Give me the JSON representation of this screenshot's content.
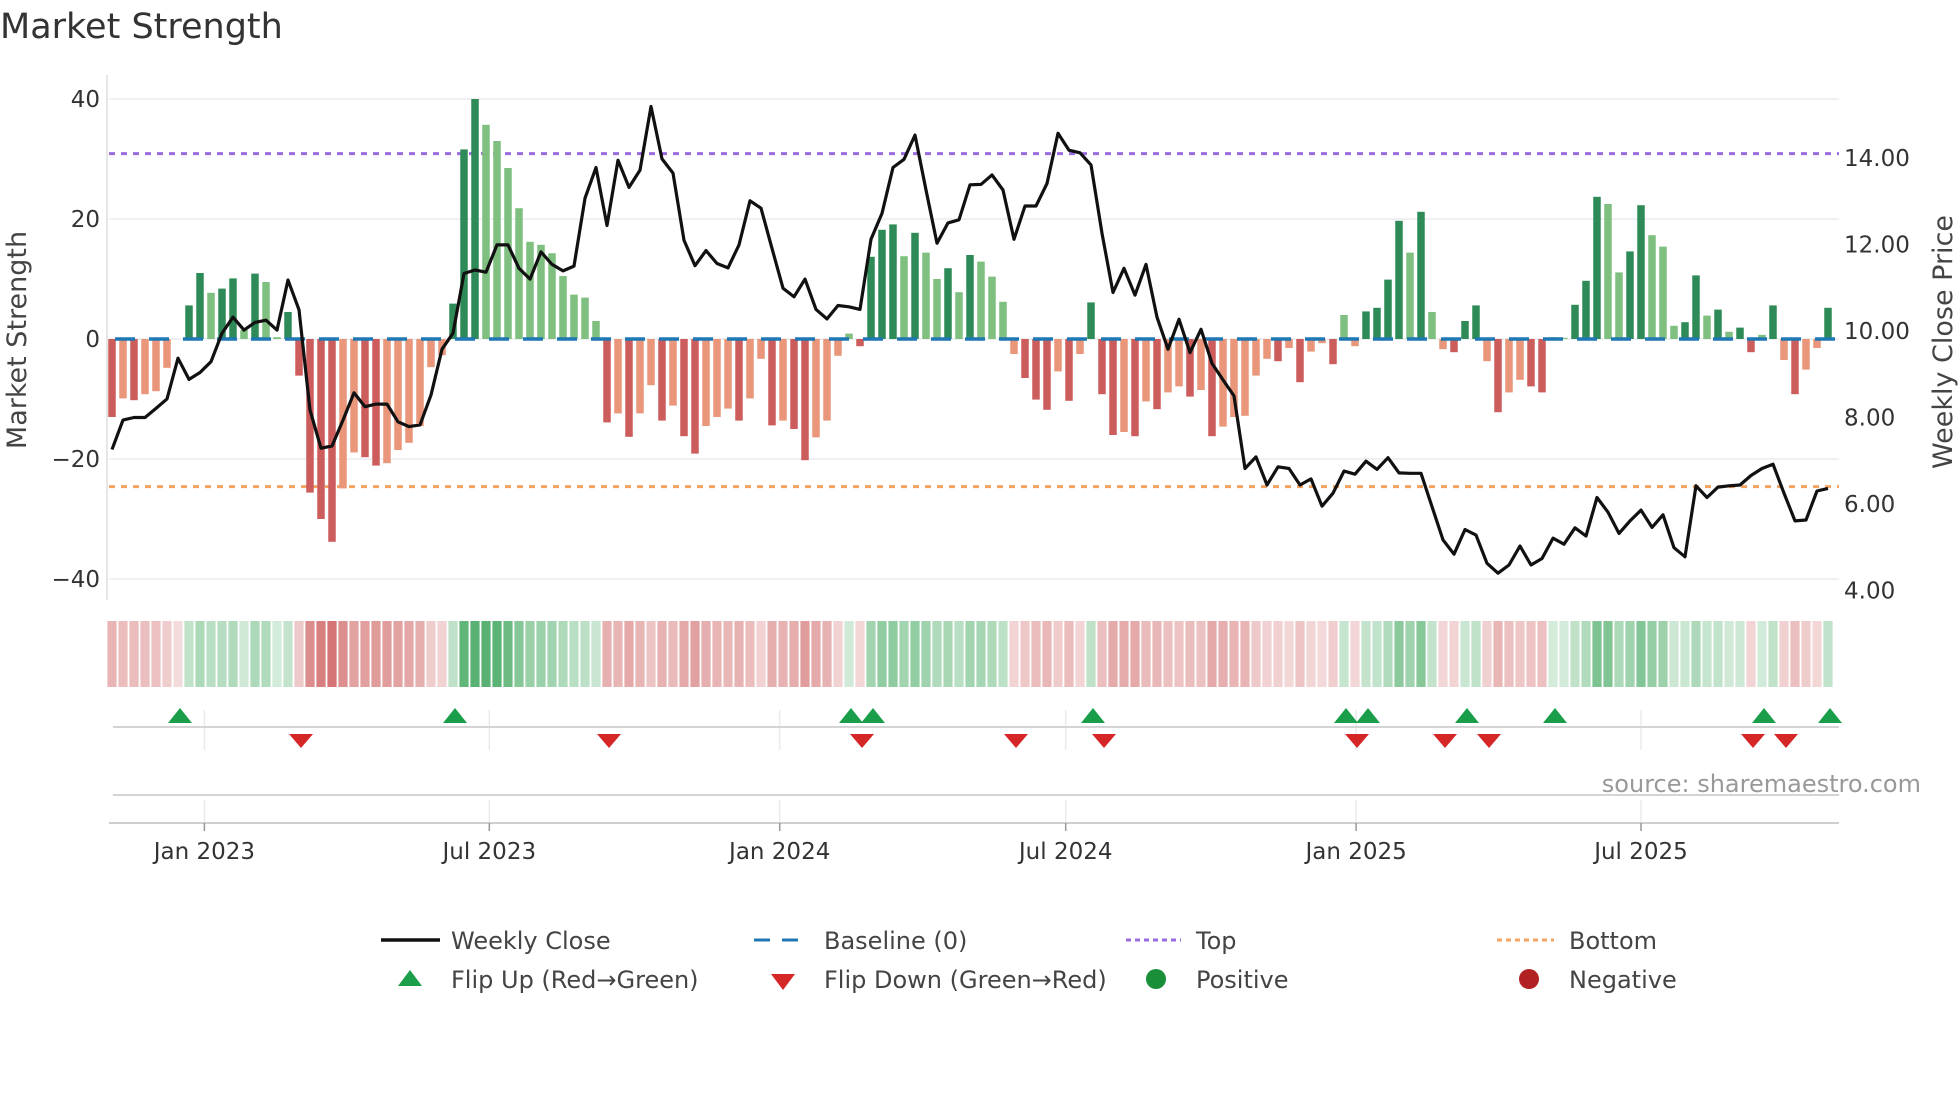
{
  "chart_data": {
    "type": "bar",
    "title": "Market Strength",
    "ylabel": "Market Strength",
    "y2label": "Weekly Close Price",
    "ylim": [
      -43,
      42
    ],
    "y2lim": [
      3.6,
      15.8
    ],
    "yticks": [
      {
        "value": 40,
        "label": "40"
      },
      {
        "value": 20,
        "label": "20"
      },
      {
        "value": 0,
        "label": "0"
      },
      {
        "value": -20,
        "label": "−20"
      },
      {
        "value": -40,
        "label": "−40"
      }
    ],
    "y2ticks": [
      {
        "value": 14,
        "label": "14.00"
      },
      {
        "value": 12,
        "label": "12.00"
      },
      {
        "value": 10,
        "label": "10.00"
      },
      {
        "value": 8,
        "label": "8.00"
      },
      {
        "value": 6,
        "label": "6.00"
      },
      {
        "value": 4,
        "label": "4.00"
      }
    ],
    "xticks": [
      {
        "week_index": 8.4,
        "label": "Jan 2023"
      },
      {
        "week_index": 34.3,
        "label": "Jul 2023"
      },
      {
        "week_index": 60.7,
        "label": "Jan 2024"
      },
      {
        "week_index": 86.7,
        "label": "Jul 2024"
      },
      {
        "week_index": 113.1,
        "label": "Jan 2025"
      },
      {
        "week_index": 139.0,
        "label": "Jul 2025"
      }
    ],
    "grid": true,
    "top_level": 30.9,
    "bottom_level": -24.6,
    "baseline": 0,
    "strength": [
      -13,
      -9.9,
      -10.2,
      -9.2,
      -8.7,
      -4.8,
      0,
      5.6,
      11,
      7.7,
      8.4,
      10.1,
      1.5,
      10.9,
      9.5,
      0.3,
      4.5,
      -6.1,
      -25.6,
      -30,
      -33.8,
      -24.9,
      -18.9,
      -19.7,
      -21.1,
      -20.7,
      -18.5,
      -17.3,
      -14.5,
      -4.7,
      -2.7,
      5.9,
      31.6,
      40,
      35.7,
      33,
      28.5,
      21.8,
      16.2,
      15.7,
      14.3,
      10.5,
      7.4,
      6.9,
      3.0,
      -13.9,
      -12.4,
      -16.3,
      -12.4,
      -7.7,
      -13.6,
      -11.1,
      -16.2,
      -19.1,
      -14.5,
      -13,
      -11.6,
      -13.6,
      -9.9,
      -3.3,
      -14.4,
      -13.6,
      -15,
      -20.2,
      -16.4,
      -13.6,
      -2.8,
      0.9,
      -1.2,
      13.7,
      18.2,
      19.1,
      13.8,
      17.7,
      14.4,
      10,
      11.8,
      7.8,
      14,
      12.9,
      10.4,
      6.2,
      -2.5,
      -6.5,
      -10.1,
      -11.8,
      -5.4,
      -10.3,
      -2.5,
      6.1,
      -9.2,
      -16,
      -15.5,
      -16.2,
      -10.4,
      -11.7,
      -8.9,
      -7.9,
      -9.6,
      -8.5,
      -16.2,
      -14.6,
      -13,
      -12.8,
      -6.1,
      -3.3,
      -3.7,
      -1.5,
      -7.2,
      -2.1,
      -0.7,
      -4.2,
      4,
      -1.2,
      4.6,
      5.2,
      9.9,
      19.7,
      14.4,
      21.2,
      4.5,
      -1.7,
      -2.2,
      3,
      5.6,
      -3.7,
      -12.2,
      -8.9,
      -6.8,
      -7.9,
      -8.9,
      0.3,
      0.2,
      5.7,
      9.7,
      23.7,
      22.5,
      11.1,
      14.6,
      22.3,
      17.3,
      15.4,
      2.2,
      2.8,
      10.6,
      3.9,
      4.9,
      1.2,
      1.9,
      -2.2,
      0.7,
      5.6,
      -3.5,
      -9.2,
      -5.1,
      -1.5,
      5.2
    ],
    "weekly_close": [
      7.26,
      7.94,
      8.0,
      8.0,
      8.21,
      8.43,
      9.37,
      8.88,
      9.04,
      9.29,
      9.95,
      10.32,
      10.02,
      10.2,
      10.25,
      10.02,
      11.18,
      10.49,
      8.17,
      7.29,
      7.34,
      7.94,
      8.57,
      8.25,
      8.31,
      8.31,
      7.9,
      7.79,
      7.83,
      8.52,
      9.58,
      9.95,
      11.33,
      11.41,
      11.36,
      11.99,
      11.99,
      11.45,
      11.2,
      11.83,
      11.54,
      11.39,
      11.5,
      13.07,
      13.78,
      12.44,
      13.95,
      13.32,
      13.72,
      15.19,
      13.98,
      13.65,
      12.1,
      11.51,
      11.86,
      11.56,
      11.46,
      11.99,
      13.01,
      12.84,
      11.91,
      10.99,
      10.79,
      11.2,
      10.5,
      10.28,
      10.59,
      10.56,
      10.5,
      12.12,
      12.72,
      13.78,
      13.97,
      14.53,
      13.26,
      12.03,
      12.5,
      12.57,
      13.38,
      13.39,
      13.61,
      13.26,
      12.12,
      12.89,
      12.89,
      13.41,
      14.57,
      14.18,
      14.12,
      13.84,
      12.26,
      10.89,
      11.45,
      10.83,
      11.54,
      10.32,
      9.58,
      10.27,
      9.5,
      10.04,
      9.25,
      8.87,
      8.5,
      6.82,
      7.09,
      6.44,
      6.86,
      6.82,
      6.44,
      6.58,
      5.95,
      6.25,
      6.76,
      6.69,
      6.99,
      6.8,
      7.07,
      6.72,
      6.71,
      6.71,
      5.94,
      5.17,
      4.84,
      5.41,
      5.28,
      4.63,
      4.4,
      4.59,
      5.03,
      4.59,
      4.74,
      5.21,
      5.07,
      5.45,
      5.26,
      6.15,
      5.81,
      5.32,
      5.61,
      5.86,
      5.46,
      5.75,
      4.99,
      4.78,
      6.42,
      6.15,
      6.39,
      6.42,
      6.44,
      6.66,
      6.82,
      6.92,
      6.25,
      5.61,
      5.63,
      6.3,
      6.36
    ],
    "flip_up_weeks": [
      6,
      31,
      67,
      69,
      89,
      112,
      114,
      123,
      131,
      150,
      156
    ],
    "flip_down_weeks": [
      17,
      45,
      68,
      82,
      90,
      113,
      121,
      125,
      149,
      152
    ],
    "legend": {
      "placement": "bottom-center",
      "items": [
        {
          "label": "Weekly Close",
          "symbol": "line"
        },
        {
          "label": "Baseline (0)",
          "symbol": "dashed"
        },
        {
          "label": "Top",
          "symbol": "dotted-purple"
        },
        {
          "label": "Bottom",
          "symbol": "dotted-orange"
        },
        {
          "label": "Flip Up (Red→Green)",
          "symbol": "triangle-up"
        },
        {
          "label": "Flip Down (Green→Red)",
          "symbol": "triangle-down"
        },
        {
          "label": "Positive",
          "symbol": "circle-green"
        },
        {
          "label": "Negative",
          "symbol": "circle-red"
        }
      ]
    },
    "source": "source: sharemaestro.com"
  },
  "colors": {
    "pos_strong": "#2e8b57",
    "pos_weak": "#7fbf7f",
    "neg_strong": "#cd5c5c",
    "neg_weak": "#e9967a",
    "baseline": "#1f77b4",
    "top": "#9b6be0",
    "bottom": "#f4a460",
    "flip_up": "#1a9e4a",
    "flip_down": "#d62728",
    "positive": "#1a8f3a",
    "negative": "#b22222",
    "line": "#111111"
  }
}
